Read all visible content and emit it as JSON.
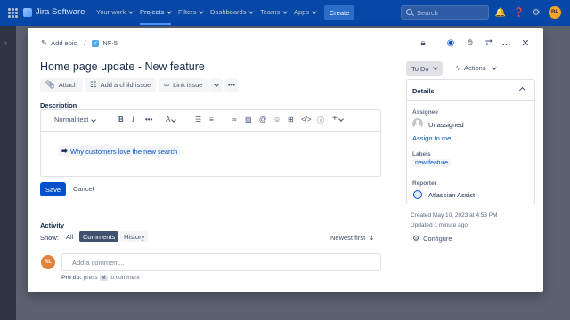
{
  "topbar": {
    "brand": "Jira Software",
    "nav": [
      {
        "label": "Your work",
        "active": false
      },
      {
        "label": "Projects",
        "active": true
      },
      {
        "label": "Filters",
        "active": false
      },
      {
        "label": "Dashboards",
        "active": false
      },
      {
        "label": "Teams",
        "active": false
      },
      {
        "label": "Apps",
        "active": false
      }
    ],
    "create_label": "Create",
    "search_placeholder": "Search",
    "avatar_initials": "RL",
    "icons": [
      "notification-icon",
      "help-icon",
      "settings-icon"
    ]
  },
  "issue": {
    "breadcrumb_add_epic": "Add epic",
    "breadcrumb_sep": "/",
    "issue_key": "NF-5",
    "title": "Home page update - New feature",
    "actions": {
      "attach": "Attach",
      "add_child": "Add a child issue",
      "link_issue": "Link issue"
    },
    "description_label": "Description",
    "editor": {
      "text_style": "Normal text",
      "smart_link": "Why customers love the new search"
    },
    "save_label": "Save",
    "cancel_label": "Cancel",
    "activity": {
      "heading": "Activity",
      "show_label": "Show:",
      "filters": [
        "All",
        "Comments",
        "History"
      ],
      "selected_filter": "Comments",
      "sort_label": "Newest first",
      "comment_placeholder": "Add a comment...",
      "avatar_initials": "RL",
      "pro_tip_prefix": "Pro tip:",
      "pro_tip_press": "press",
      "pro_tip_key": "M",
      "pro_tip_suffix": "to comment"
    }
  },
  "sidepanel": {
    "status": "To Do",
    "actions_label": "Actions",
    "details_heading": "Details",
    "assignee_label": "Assignee",
    "assignee_value": "Unassigned",
    "assign_to_me": "Assign to me",
    "labels_label": "Labels",
    "label_value": "new-feature",
    "reporter_label": "Reporter",
    "reporter_value": "Atlassian Assist",
    "created": "Created May 10, 2023 at 4:53 PM",
    "updated": "Updated 1 minute ago",
    "configure": "Configure"
  },
  "colors": {
    "topbar": "#0747a6",
    "primary": "#0052cc",
    "avatar": "#f5a623",
    "comment_avatar": "#e2813a"
  }
}
